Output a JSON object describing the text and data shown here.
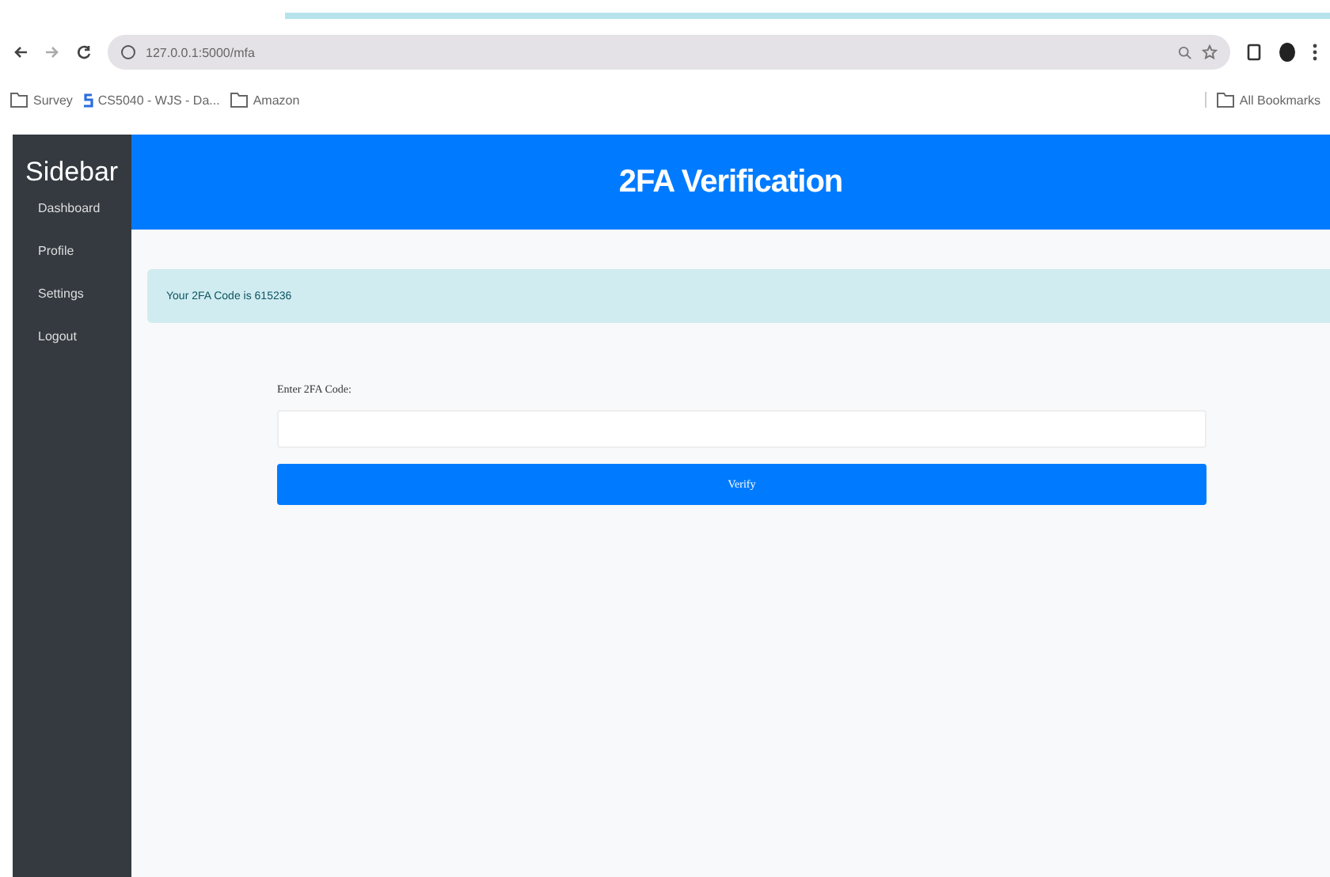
{
  "browser": {
    "url": "127.0.0.1:5000/mfa",
    "bookmarks": [
      {
        "label": "Survey",
        "kind": "folder"
      },
      {
        "label": "CS5040 - WJS - Da...",
        "kind": "site"
      },
      {
        "label": "Amazon",
        "kind": "folder"
      }
    ],
    "all_bookmarks": "All Bookmarks"
  },
  "sidebar": {
    "title": "Sidebar",
    "items": [
      "Dashboard",
      "Profile",
      "Settings",
      "Logout"
    ]
  },
  "header": {
    "title": "2FA Verification"
  },
  "alert": "Your 2FA Code is 615236",
  "form": {
    "label": "Enter 2FA Code:",
    "button": "Verify"
  }
}
